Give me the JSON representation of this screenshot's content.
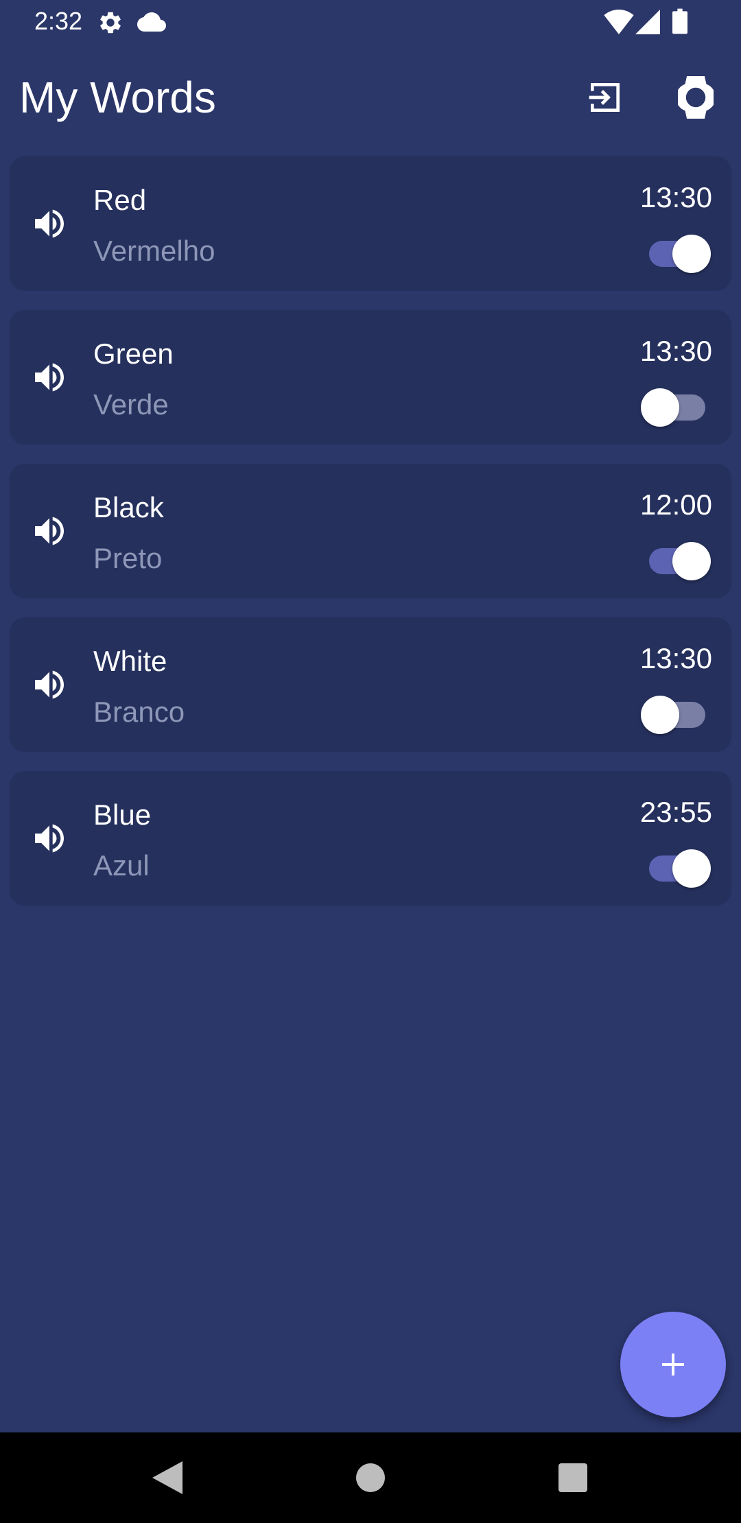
{
  "status_bar": {
    "time": "2:32",
    "icons": [
      "gear-icon",
      "cloud-icon",
      "wifi-icon",
      "signal-icon",
      "battery-icon"
    ]
  },
  "app_bar": {
    "title": "My Words",
    "actions": [
      "export-icon",
      "watch-icon"
    ]
  },
  "words": [
    {
      "word": "Red",
      "translation": "Vermelho",
      "time": "13:30",
      "enabled": true
    },
    {
      "word": "Green",
      "translation": "Verde",
      "time": "13:30",
      "enabled": false
    },
    {
      "word": "Black",
      "translation": "Preto",
      "time": "12:00",
      "enabled": true
    },
    {
      "word": "White",
      "translation": "Branco",
      "time": "13:30",
      "enabled": false
    },
    {
      "word": "Blue",
      "translation": "Azul",
      "time": "23:55",
      "enabled": true
    }
  ],
  "fab": {
    "icon": "plus-icon"
  },
  "nav_bar": {
    "buttons": [
      "back-icon",
      "home-icon",
      "recents-icon"
    ]
  },
  "colors": {
    "background": "#2b3669",
    "card": "#25305d",
    "secondary_text": "#8f97b8",
    "toggle_on_track": "#5d63b3",
    "toggle_off_track": "#7a7fa6",
    "fab": "#7b80f5"
  }
}
